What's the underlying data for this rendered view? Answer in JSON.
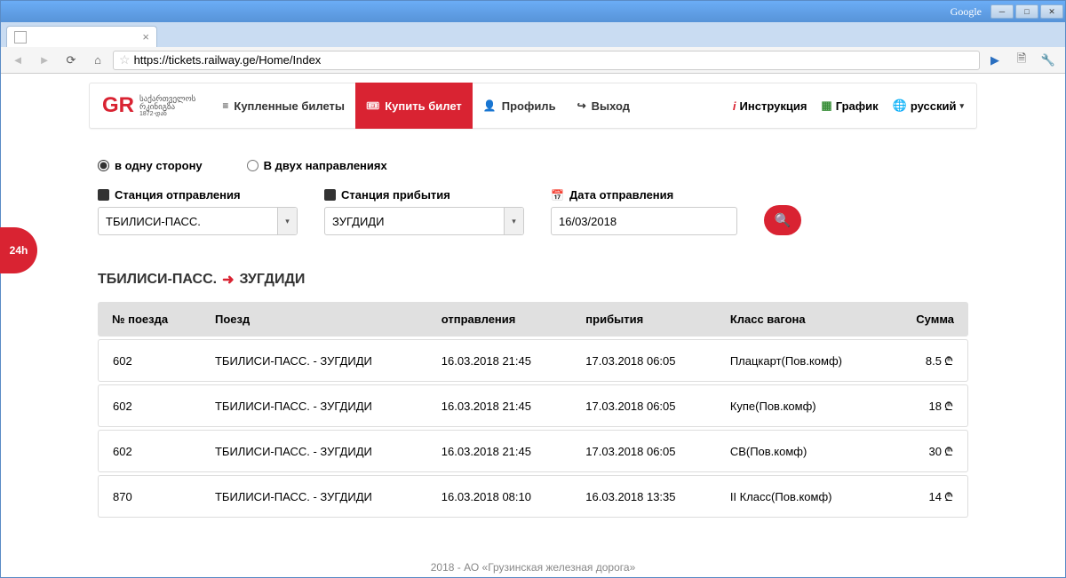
{
  "browser": {
    "google_label": "Google",
    "url": "https://tickets.railway.ge/Home/Index",
    "tab_title": ""
  },
  "nav": {
    "my_tickets": "Купленные билеты",
    "buy": "Купить билет",
    "profile": "Профиль",
    "logout": "Выход",
    "instruction": "Инструкция",
    "schedule": "График",
    "language": "русский"
  },
  "logo": {
    "main": "GR",
    "sub1": "საქართველოს",
    "sub2": "რკინიგზა",
    "sub3": "1872-დან"
  },
  "search": {
    "one_way": "в одну сторону",
    "round_trip": "В двух направлениях",
    "from_label": "Станция отправления",
    "to_label": "Станция прибытия",
    "date_label": "Дата отправления",
    "from_value": "ТБИЛИСИ-ПАСС.",
    "to_value": "ЗУГДИДИ",
    "date_value": "16/03/2018"
  },
  "route": {
    "from": "ТБИЛИСИ-ПАСС.",
    "to": "ЗУГДИДИ"
  },
  "columns": {
    "num": "№ поезда",
    "train": "Поезд",
    "dep": "отправления",
    "arr": "прибытия",
    "class": "Класс вагона",
    "sum": "Сумма"
  },
  "rows": [
    {
      "num": "602",
      "train": "ТБИЛИСИ-ПАСС. - ЗУГДИДИ",
      "dep": "16.03.2018 21:45",
      "arr": "17.03.2018 06:05",
      "class": "Плацкарт(Пов.комф)",
      "sum": "8.5"
    },
    {
      "num": "602",
      "train": "ТБИЛИСИ-ПАСС. - ЗУГДИДИ",
      "dep": "16.03.2018 21:45",
      "arr": "17.03.2018 06:05",
      "class": "Купе(Пов.комф)",
      "sum": "18"
    },
    {
      "num": "602",
      "train": "ТБИЛИСИ-ПАСС. - ЗУГДИДИ",
      "dep": "16.03.2018 21:45",
      "arr": "17.03.2018 06:05",
      "class": "СВ(Пов.комф)",
      "sum": "30"
    },
    {
      "num": "870",
      "train": "ТБИЛИСИ-ПАСС. - ЗУГДИДИ",
      "dep": "16.03.2018 08:10",
      "arr": "16.03.2018 13:35",
      "class": "II Класс(Пов.комф)",
      "sum": "14"
    }
  ],
  "badge_24h": "24h",
  "footer": "2018 - АО «Грузинская железная дорога»"
}
